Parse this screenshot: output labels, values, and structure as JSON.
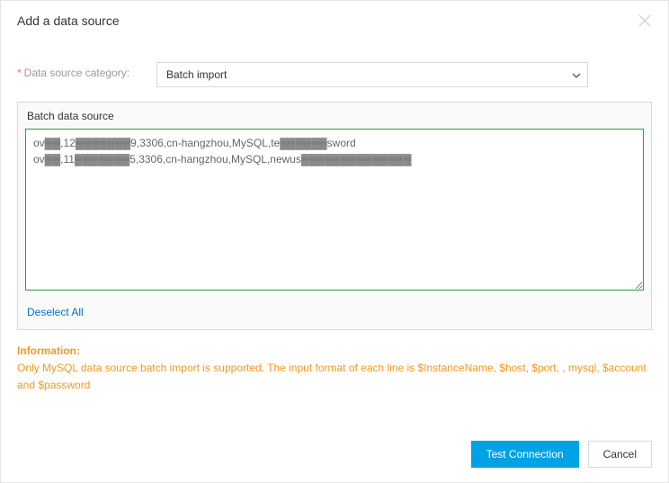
{
  "header": {
    "title": "Add a data source"
  },
  "form": {
    "category_label": "Data source category:",
    "category_value": "Batch import"
  },
  "batch": {
    "section_title": "Batch data source",
    "textarea_value": "ov▓▓,12▓▓▓▓▓▓▓9,3306,cn-hangzhou,MySQL,te▓▓▓▓▓▓sword\nov▓▓,11▓▓▓▓▓▓▓5,3306,cn-hangzhou,MySQL,newus▓▓▓▓▓▓▓▓▓▓▓▓▓▓",
    "deselect_label": "Deselect All"
  },
  "info": {
    "title": "Information:",
    "text": "Only MySQL data source batch import is supported. The input format of each line is $InstanceName, $host, $port, , mysql, $account and $password"
  },
  "footer": {
    "test_connection_label": "Test Connection",
    "cancel_label": "Cancel"
  }
}
